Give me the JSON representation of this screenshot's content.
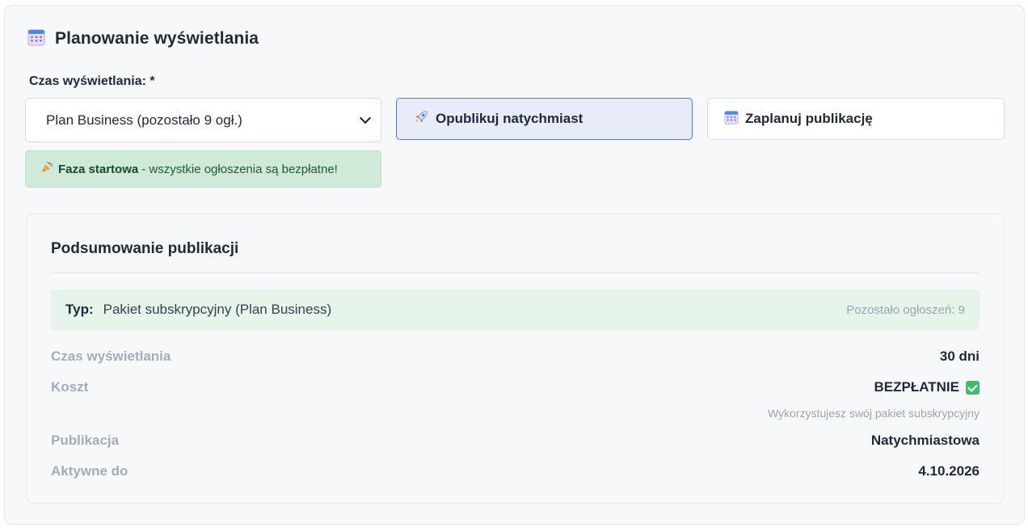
{
  "header": {
    "title": "Planowanie wyświetlania",
    "icon": "calendar-icon"
  },
  "form": {
    "duration_label": "Czas wyświetlania: *",
    "duration_select_value": "Plan Business (pozostało 9 ogł.)",
    "publish_now_label": "Opublikuj natychmiast",
    "schedule_label": "Zaplanuj publikację",
    "selected_option": "publish_now"
  },
  "alert": {
    "bold": "Faza startowa",
    "text": "- wszystkie ogłoszenia są bezpłatne!"
  },
  "summary": {
    "title": "Podsumowanie publikacji",
    "type_key": "Typ:",
    "type_value": "Pakiet subskrypcyjny (Plan Business)",
    "remaining": "Pozostało ogłoszeń: 9",
    "rows": [
      {
        "key": "Czas wyświetlania",
        "value": "30 dni"
      },
      {
        "key": "Koszt",
        "value": "BEZPŁATNIE"
      },
      {
        "key": "Publikacja",
        "value": "Natychmiastowa"
      },
      {
        "key": "Aktywne do",
        "value": "4.10.2026"
      }
    ],
    "cost_note": "Wykorzystujesz swój pakiet subskrypcyjny"
  },
  "colors": {
    "accent_border": "#5c75d3",
    "selected_bg": "#e7ecf8",
    "success_bg": "#cfead8",
    "check_green": "#3ebd6a"
  }
}
